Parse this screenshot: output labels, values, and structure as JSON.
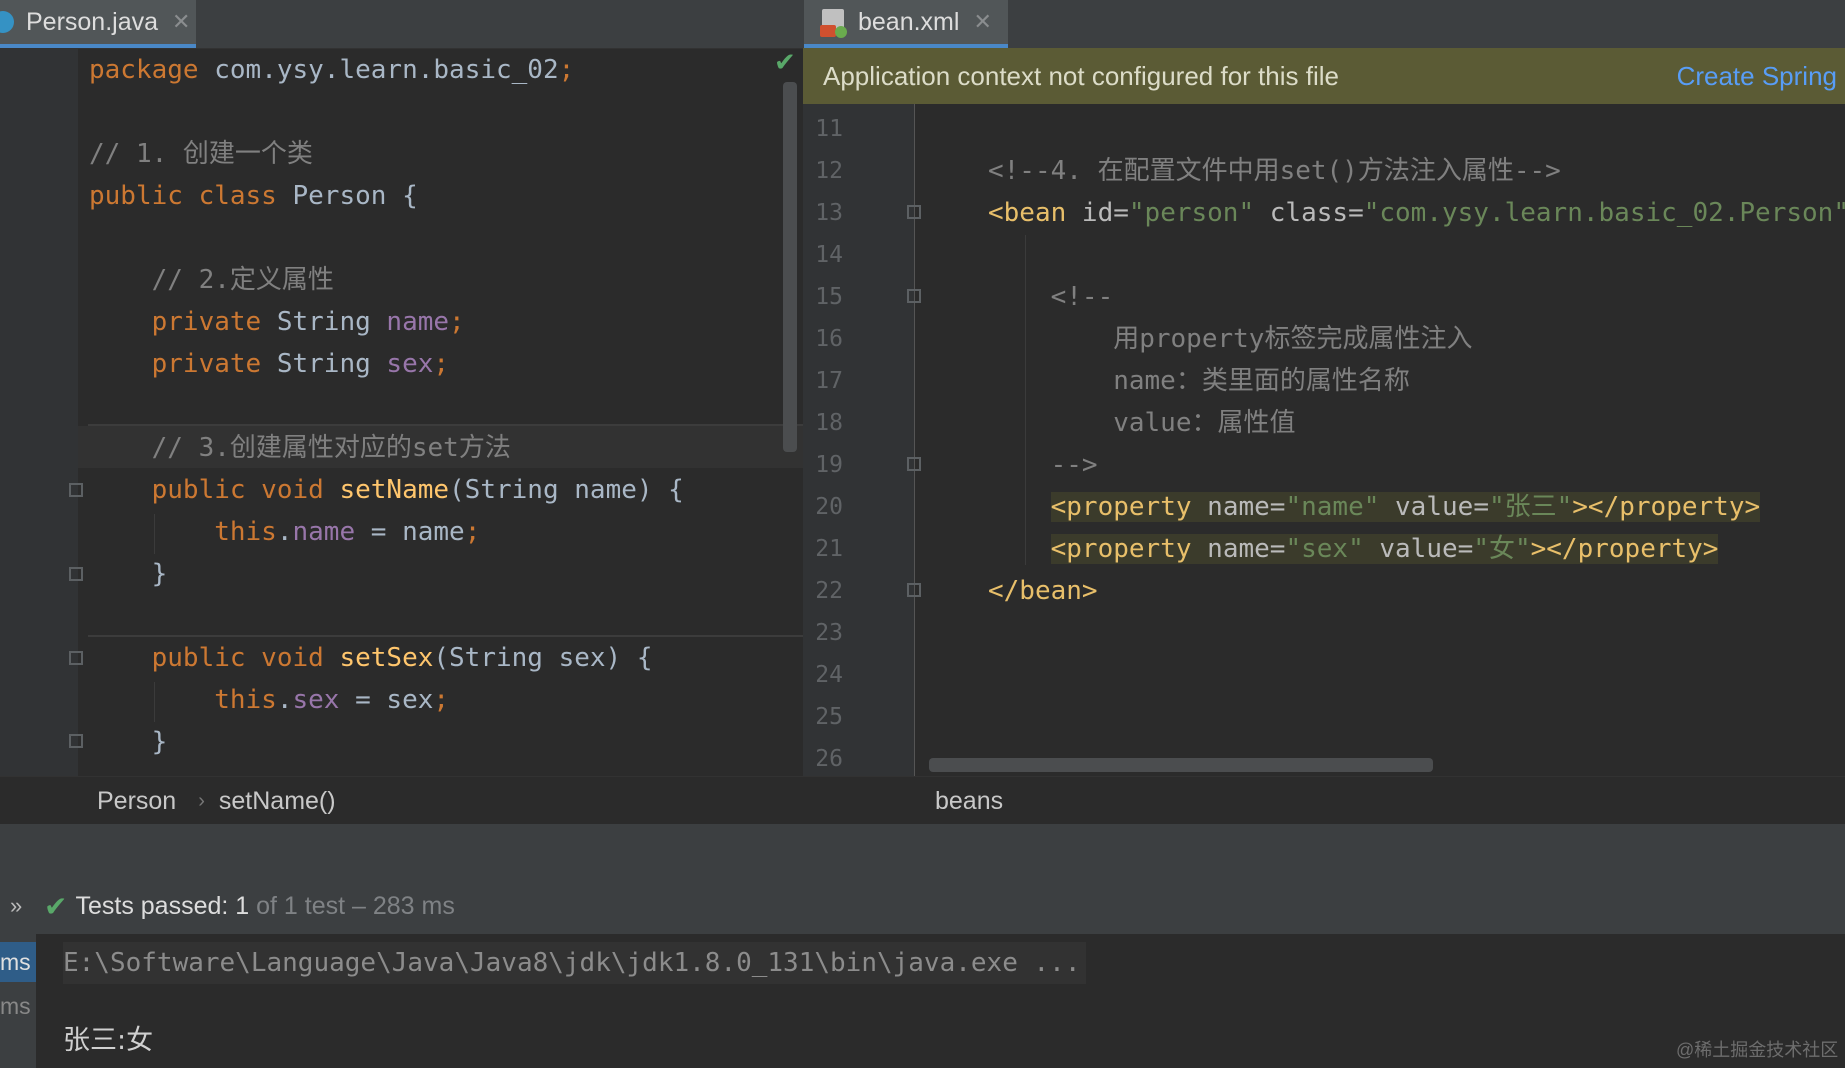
{
  "left_editor": {
    "tab_label": "Person.java",
    "lines": [
      [
        {
          "t": "package ",
          "c": "kw"
        },
        {
          "t": "com.ysy.learn.basic_02",
          "c": ""
        },
        {
          "t": ";",
          "c": "kw"
        }
      ],
      [],
      [
        {
          "t": "// 1. 创建一个类",
          "c": "cm"
        }
      ],
      [
        {
          "t": "public class ",
          "c": "kw"
        },
        {
          "t": "Person {",
          "c": ""
        }
      ],
      [],
      [
        {
          "t": "    // 2.定义属性",
          "c": "cm"
        }
      ],
      [
        {
          "t": "    private ",
          "c": "kw"
        },
        {
          "t": "String ",
          "c": ""
        },
        {
          "t": "name",
          "c": "fld"
        },
        {
          "t": ";",
          "c": "kw"
        }
      ],
      [
        {
          "t": "    private ",
          "c": "kw"
        },
        {
          "t": "String ",
          "c": ""
        },
        {
          "t": "sex",
          "c": "fld"
        },
        {
          "t": ";",
          "c": "kw"
        }
      ],
      [],
      [
        {
          "t": "    // 3.创建属性对应的set方法",
          "c": "cm"
        }
      ],
      [
        {
          "t": "    public void ",
          "c": "kw"
        },
        {
          "t": "setName",
          "c": "fn"
        },
        {
          "t": "(String name) {",
          "c": ""
        }
      ],
      [
        {
          "t": "        this",
          "c": "kw"
        },
        {
          "t": ".",
          "c": ""
        },
        {
          "t": "name",
          "c": "fld"
        },
        {
          "t": " = name",
          "c": ""
        },
        {
          "t": ";",
          "c": "kw"
        }
      ],
      [
        {
          "t": "    }",
          "c": ""
        }
      ],
      [],
      [
        {
          "t": "    public void ",
          "c": "kw"
        },
        {
          "t": "setSex",
          "c": "fn"
        },
        {
          "t": "(String sex) {",
          "c": ""
        }
      ],
      [
        {
          "t": "        this",
          "c": "kw"
        },
        {
          "t": ".",
          "c": ""
        },
        {
          "t": "sex",
          "c": "fld"
        },
        {
          "t": " = sex",
          "c": ""
        },
        {
          "t": ";",
          "c": "kw"
        }
      ],
      [
        {
          "t": "    }",
          "c": ""
        }
      ]
    ],
    "breadcrumb": [
      "Person",
      "setName()"
    ]
  },
  "right_editor": {
    "tab_label": "bean.xml",
    "banner_message": "Application context not configured for this file",
    "banner_link": "Create Spring",
    "line_numbers": [
      "11",
      "12",
      "13",
      "14",
      "15",
      "16",
      "17",
      "18",
      "19",
      "20",
      "21",
      "22",
      "23",
      "24",
      "25",
      "26"
    ],
    "lines": [
      [],
      [
        {
          "t": "<!--4. 在配置文件中用set()方法注入属性-->",
          "c": "cm"
        }
      ],
      [
        {
          "t": "<bean ",
          "c": "tag"
        },
        {
          "t": "id",
          "c": "attr"
        },
        {
          "t": "=",
          "c": "attr"
        },
        {
          "t": "\"person\" ",
          "c": "val"
        },
        {
          "t": "class",
          "c": "attr"
        },
        {
          "t": "=",
          "c": "attr"
        },
        {
          "t": "\"com.ysy.learn.basic_02.Person\"",
          "c": "val"
        },
        {
          "t": ">",
          "c": "tag"
        }
      ],
      [],
      [
        {
          "t": "    <!--",
          "c": "cm"
        }
      ],
      [
        {
          "t": "        用property标签完成属性注入",
          "c": "cm"
        }
      ],
      [
        {
          "t": "        name：类里面的属性名称",
          "c": "cm"
        }
      ],
      [
        {
          "t": "        value：属性值",
          "c": "cm"
        }
      ],
      [
        {
          "t": "    -->",
          "c": "cm"
        }
      ],
      [
        {
          "t": "    ",
          "c": ""
        },
        {
          "t": "<property ",
          "c": "tag hl"
        },
        {
          "t": "name",
          "c": "attr hl"
        },
        {
          "t": "=",
          "c": "attr hl"
        },
        {
          "t": "\"name\" ",
          "c": "val hl"
        },
        {
          "t": "value",
          "c": "attr hl"
        },
        {
          "t": "=",
          "c": "attr hl"
        },
        {
          "t": "\"张三\"",
          "c": "val hl"
        },
        {
          "t": "></property>",
          "c": "tag hl"
        }
      ],
      [
        {
          "t": "    ",
          "c": ""
        },
        {
          "t": "<property ",
          "c": "tag hl"
        },
        {
          "t": "name",
          "c": "attr hl"
        },
        {
          "t": "=",
          "c": "attr hl"
        },
        {
          "t": "\"sex\" ",
          "c": "val hl"
        },
        {
          "t": "value",
          "c": "attr hl"
        },
        {
          "t": "=",
          "c": "attr hl"
        },
        {
          "t": "\"女\"",
          "c": "val hl"
        },
        {
          "t": "></property>",
          "c": "tag hl"
        }
      ],
      [
        {
          "t": "</bean>",
          "c": "tag"
        }
      ],
      [],
      [],
      [],
      []
    ],
    "breadcrumb": [
      "beans"
    ]
  },
  "run_panel": {
    "status_main": "Tests passed: 1",
    "status_rest": " of 1 test – 283 ms",
    "side_labels": [
      "ms",
      "ms"
    ],
    "console_lines": [
      "E:\\Software\\Language\\Java\\Java8\\jdk\\jdk1.8.0_131\\bin\\java.exe ...",
      "张三:女"
    ]
  },
  "watermark": "@稀土掘金技术社区",
  "colors": {
    "keyword": "#cc7832",
    "comment": "#808080",
    "field": "#9876aa",
    "method": "#ffc66d",
    "tag": "#e8bf6a",
    "value": "#6a8759",
    "accent": "#4a88c7",
    "pass": "#59a869"
  }
}
